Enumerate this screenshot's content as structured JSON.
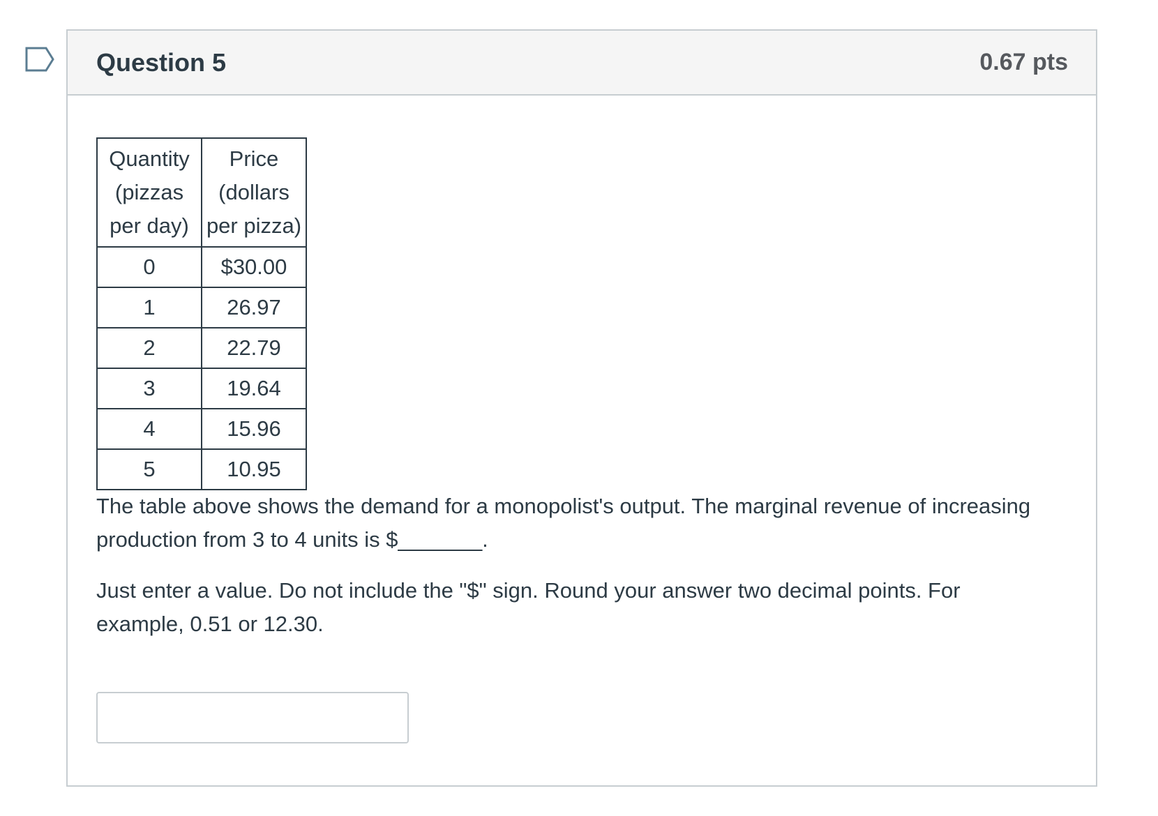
{
  "question": {
    "title": "Question 5",
    "points": "0.67 pts",
    "flag_icon": "bookmark-flag-icon"
  },
  "table": {
    "headers": [
      [
        "Quantity",
        "(pizzas",
        "per day)"
      ],
      [
        "Price",
        "(dollars",
        "per pizza)"
      ]
    ],
    "rows": [
      [
        "0",
        "$30.00"
      ],
      [
        "1",
        "26.97"
      ],
      [
        "2",
        "22.79"
      ],
      [
        "3",
        "19.64"
      ],
      [
        "4",
        "15.96"
      ],
      [
        "5",
        "10.95"
      ]
    ]
  },
  "prompt": {
    "line1": "The table above shows the demand for a monopolist's output. The marginal revenue of increasing",
    "line2": "production from 3 to 4 units is $_______."
  },
  "instructions": {
    "line1": "Just enter a value.  Do not include the \"$\" sign. Round your answer two decimal points. For",
    "line2": "example, 0.51 or 12.30."
  },
  "answer": {
    "value": "",
    "placeholder": ""
  },
  "colors": {
    "border": "#c7cdd1",
    "header_bg": "#f5f5f5",
    "text": "#2d3b45",
    "points_text": "#56595e",
    "flag_stroke": "#5b7d92"
  }
}
